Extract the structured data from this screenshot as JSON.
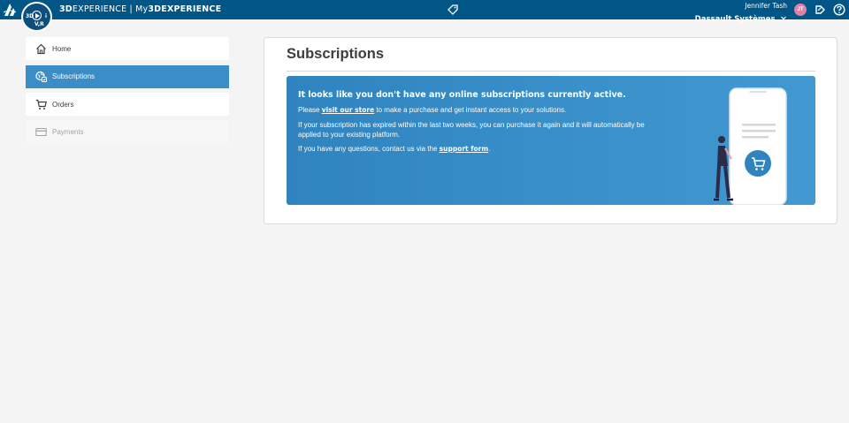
{
  "topbar": {
    "brand_bold": "3D",
    "brand_regular": "EXPERIENCE | My",
    "brand_tail": "3DEXPERIENCE",
    "compass_labels": [
      "3D",
      "i",
      "V,R"
    ],
    "user_name": "Jennifer Tash",
    "company": "Dassault Systèmes",
    "avatar_initials": "JT",
    "avatar_color": "#e07fa8",
    "bar_color": "#005686"
  },
  "sidebar": {
    "items": [
      {
        "label": "Home",
        "icon": "home-icon",
        "state": "normal"
      },
      {
        "label": "Subscriptions",
        "icon": "subscriptions-icon",
        "state": "active"
      },
      {
        "label": "Orders",
        "icon": "cart-icon",
        "state": "normal"
      },
      {
        "label": "Payments",
        "icon": "credit-card-icon",
        "state": "disabled"
      }
    ],
    "active_color": "#3b8dc7"
  },
  "main": {
    "title": "Subscriptions",
    "banner": {
      "heading": "It looks like you don't have any online subscriptions currently active.",
      "line1_pre": "Please ",
      "line1_link": "visit our store",
      "line1_post": " to make a purchase and get instant access to your solutions.",
      "line2": "If your subscription has expired within the last two weeks, you can purchase it again and it will automatically be applied to your existing platform.",
      "line3_pre": "If you have any questions, contact us via the ",
      "line3_link": "support form",
      "line3_post": "."
    }
  }
}
